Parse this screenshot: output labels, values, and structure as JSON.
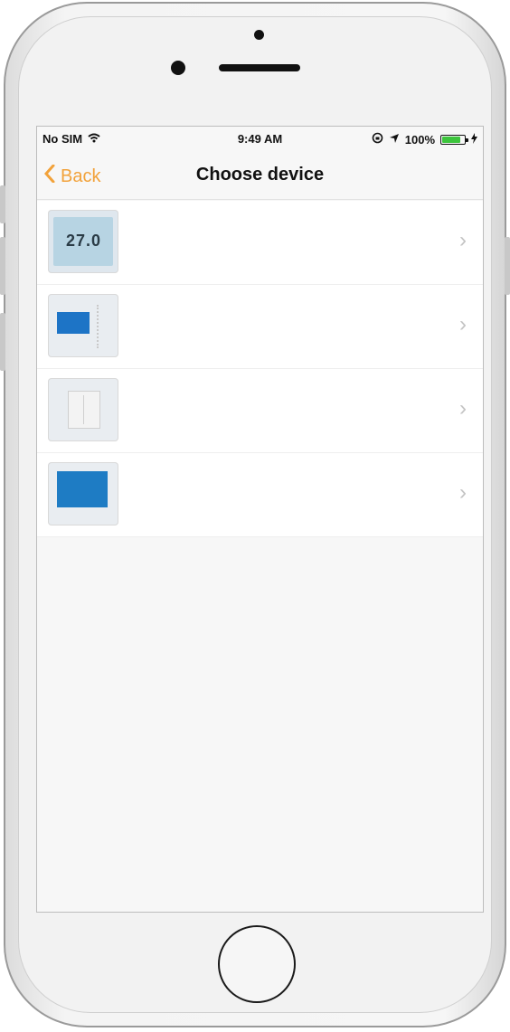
{
  "status_bar": {
    "carrier": "No SIM",
    "time": "9:49 AM",
    "battery_percent": "100%"
  },
  "nav": {
    "back_label": "Back",
    "title": "Choose device"
  },
  "devices": [
    {
      "icon": "lcd-thermostat-thumbnail"
    },
    {
      "icon": "blue-screen-thermostat-thumbnail"
    },
    {
      "icon": "white-panel-thermostat-thumbnail"
    },
    {
      "icon": "large-blue-screen-thermostat-thumbnail"
    }
  ],
  "colors": {
    "accent_back": "#f2a23a",
    "battery_green": "#3cc43c",
    "device_blue": "#1d74c6"
  }
}
